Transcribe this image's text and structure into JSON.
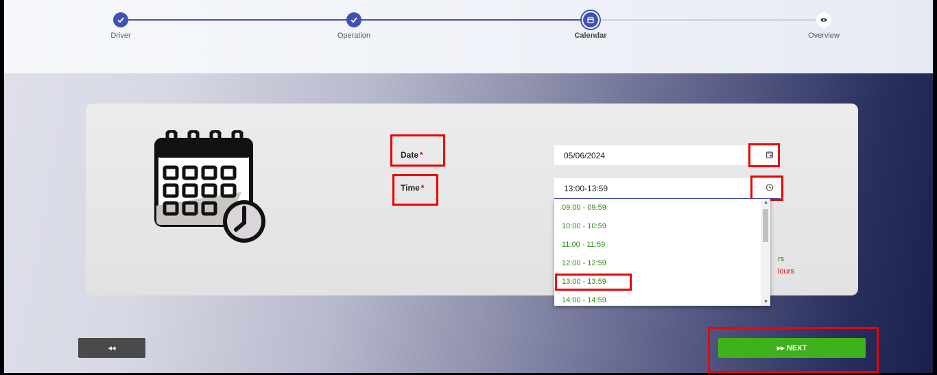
{
  "stepper": {
    "steps": [
      {
        "label": "Driver",
        "state": "done"
      },
      {
        "label": "Operation",
        "state": "done"
      },
      {
        "label": "Calendar",
        "state": "active"
      },
      {
        "label": "Overview",
        "state": "pending"
      }
    ]
  },
  "form": {
    "date_label": "Date",
    "time_label": "Time",
    "required_mark": "*",
    "date_value": "05/06/2024",
    "time_value": "13:00-13:59"
  },
  "time_options": [
    "09:00  -  09:59",
    "10:00  -  10:59",
    "11:00  -  11:59",
    "12:00  -  12:59",
    "13:00  -  13:59",
    "14:00  -  14:59"
  ],
  "legend": {
    "available_partial": "rs",
    "unavailable_partial": "lours"
  },
  "buttons": {
    "back_label": "◂◂",
    "next_label": "▸▸ NEXT"
  },
  "colors": {
    "primary": "#3f51b5",
    "available": "#2f8a17",
    "unavailable": "#e00000",
    "next": "#3fb21b"
  }
}
